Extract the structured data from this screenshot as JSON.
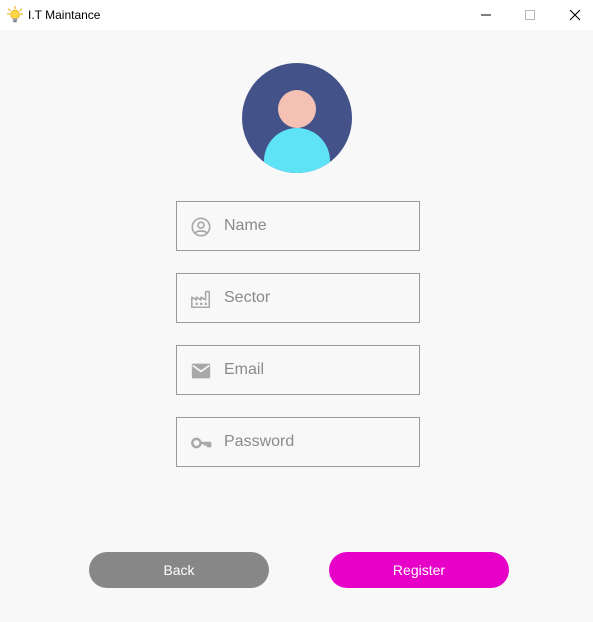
{
  "window": {
    "title": "I.T Maintance",
    "app_icon": "lightbulb-icon",
    "controls": [
      "minimize-icon",
      "maximize-icon",
      "close-icon"
    ]
  },
  "avatar": {
    "icon": "user-avatar-icon",
    "colors": {
      "background": "#44528a",
      "head": "#f6c1b5",
      "body": "#5de3f5"
    }
  },
  "form": {
    "name": {
      "icon": "user-circle-icon",
      "placeholder": "Name",
      "value": ""
    },
    "sector": {
      "icon": "factory-icon",
      "placeholder": "Sector",
      "value": ""
    },
    "email": {
      "icon": "mail-icon",
      "placeholder": "Email",
      "value": ""
    },
    "password": {
      "icon": "key-icon",
      "placeholder": "Password",
      "value": ""
    }
  },
  "buttons": {
    "back": {
      "label": "Back",
      "color": "#878787"
    },
    "register": {
      "label": "Register",
      "color": "#e600c8"
    }
  }
}
